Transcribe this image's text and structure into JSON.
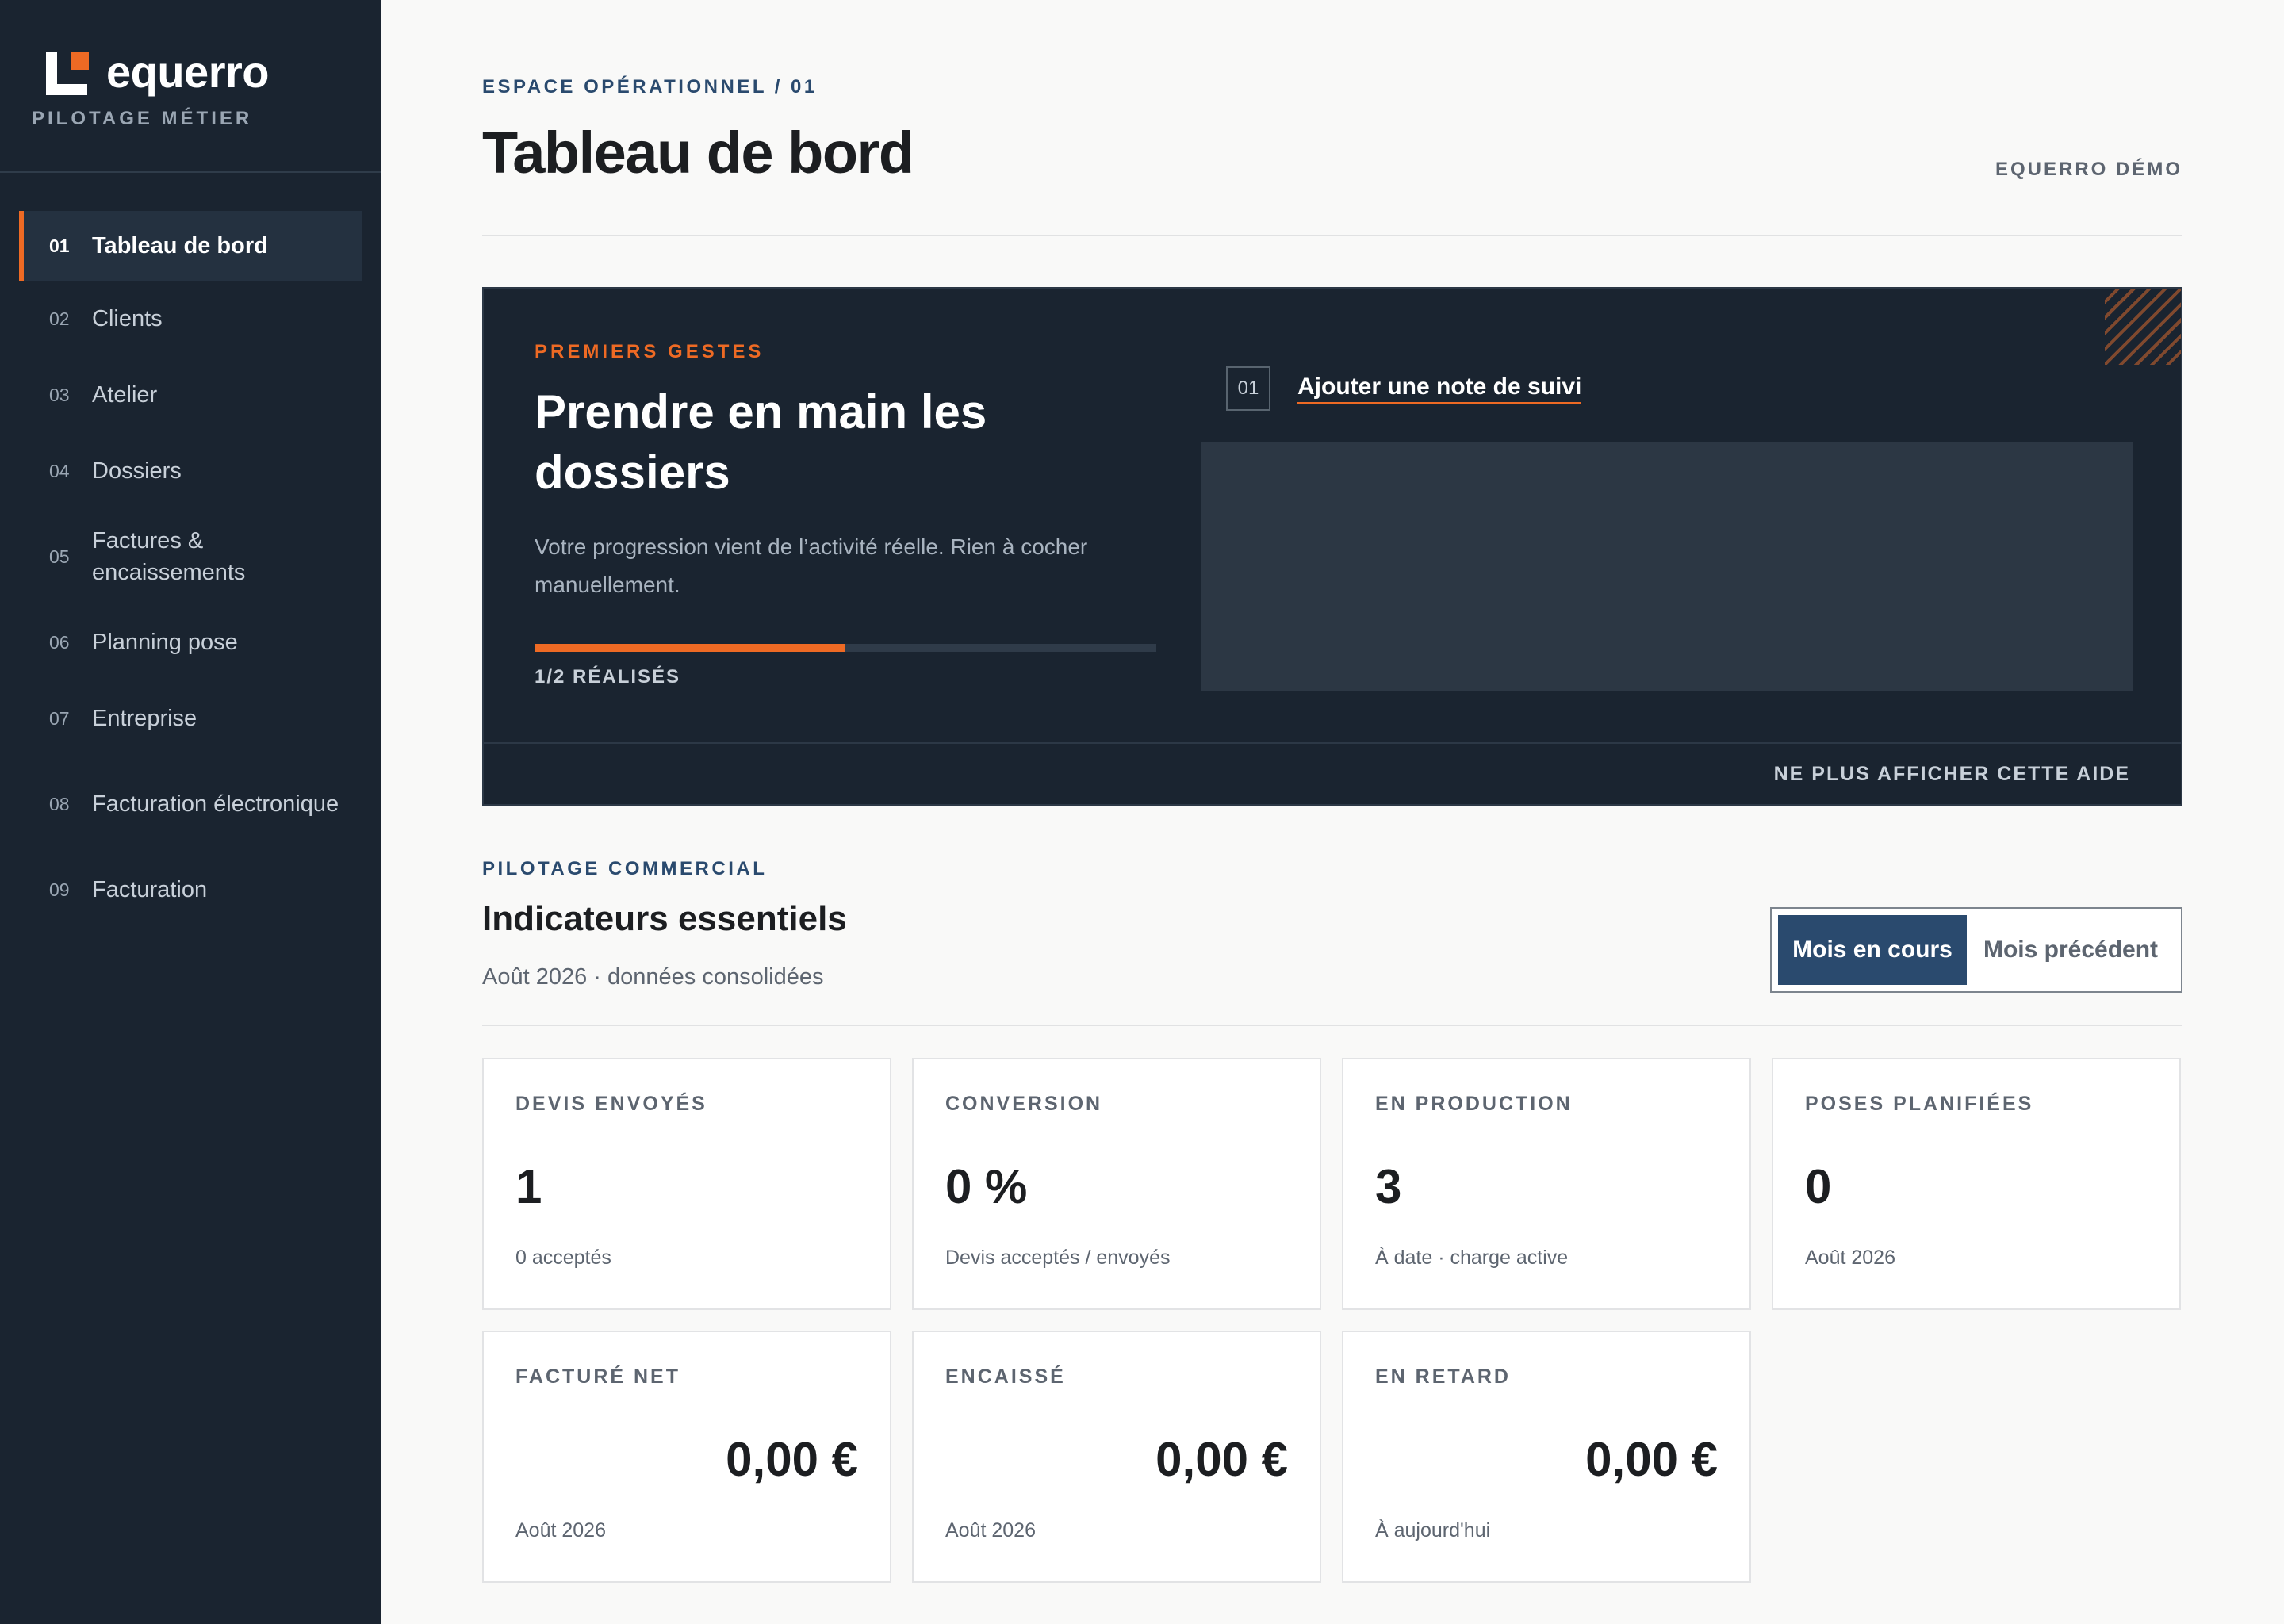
{
  "brand": {
    "name": "equerro",
    "tagline": "PILOTAGE MÉTIER",
    "accent_color": "#ee6a24",
    "sidebar_color": "#1a2430"
  },
  "sidebar": {
    "items": [
      {
        "num": "01",
        "label": "Tableau de bord",
        "active": true
      },
      {
        "num": "02",
        "label": "Clients"
      },
      {
        "num": "03",
        "label": "Atelier"
      },
      {
        "num": "04",
        "label": "Dossiers"
      },
      {
        "num": "05",
        "label": "Factures & encaissements"
      },
      {
        "num": "06",
        "label": "Planning pose"
      },
      {
        "num": "07",
        "label": "Entreprise"
      },
      {
        "num": "08",
        "label": "Facturation électronique"
      },
      {
        "num": "09",
        "label": "Facturation"
      }
    ]
  },
  "header": {
    "breadcrumb": "ESPACE OPÉRATIONNEL / 01",
    "title": "Tableau de bord",
    "workspace": "EQUERRO DÉMO"
  },
  "onboarding": {
    "eyebrow": "PREMIERS GESTES",
    "title": "Prendre en main les dossiers",
    "description": "Votre progression vient de l’activité réelle. Rien à cocher manuellement.",
    "progress_fraction": 0.5,
    "progress_label": "1/2 RÉALISÉS",
    "step": {
      "num": "01",
      "label": "Ajouter une note de suivi"
    },
    "dismiss_label": "NE PLUS AFFICHER CETTE AIDE"
  },
  "kpis": {
    "eyebrow": "PILOTAGE COMMERCIAL",
    "title": "Indicateurs essentiels",
    "subtitle": "Août 2026 · données consolidées",
    "toggle": {
      "active": "Mois en cours",
      "inactive": "Mois précédent"
    },
    "cards": [
      {
        "label": "DEVIS ENVOYÉS",
        "value": "1",
        "note": "0 acceptés"
      },
      {
        "label": "CONVERSION",
        "value": "0 %",
        "note": "Devis acceptés / envoyés"
      },
      {
        "label": "EN PRODUCTION",
        "value": "3",
        "note": "À date · charge active"
      },
      {
        "label": "POSES PLANIFIÉES",
        "value": "0",
        "note": "Août 2026"
      },
      {
        "label": "FACTURÉ NET",
        "value": "0,00 €",
        "note": "Août 2026"
      },
      {
        "label": "ENCAISSÉ",
        "value": "0,00 €",
        "note": "Août 2026"
      },
      {
        "label": "EN RETARD",
        "value": "0,00 €",
        "note": "À aujourd'hui"
      }
    ]
  }
}
